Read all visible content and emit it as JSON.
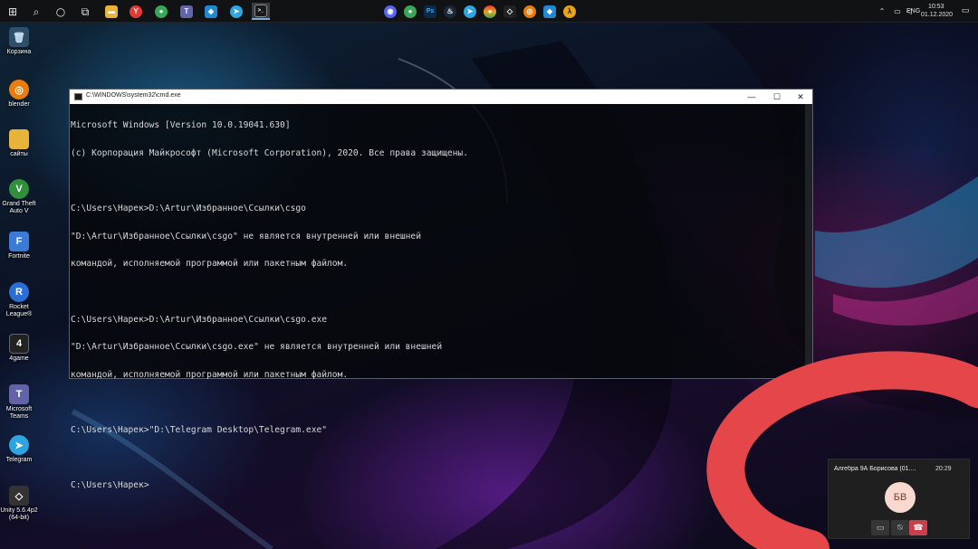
{
  "taskbar": {
    "left_buttons": [
      {
        "name": "start-button",
        "glyph": "⊞"
      },
      {
        "name": "search-button",
        "glyph": "⌕"
      },
      {
        "name": "cortana-button",
        "glyph": "○"
      },
      {
        "name": "task-view-button",
        "glyph": "⧉"
      }
    ],
    "pinned_apps": [
      {
        "name": "file-explorer-icon",
        "glyph": "▬",
        "color": "#e8b339"
      },
      {
        "name": "yandex-browser-icon",
        "glyph": "Y",
        "color": "#e53935"
      },
      {
        "name": "chrome-icon",
        "glyph": "●",
        "color": "#3aa757"
      },
      {
        "name": "teams-icon",
        "glyph": "T",
        "color": "#6264a7"
      },
      {
        "name": "vscode-icon",
        "glyph": "◆",
        "color": "#1f8ad2"
      },
      {
        "name": "telegram-icon",
        "glyph": "➤",
        "color": "#2ca5e0"
      },
      {
        "name": "cmd-icon",
        "glyph": ">_",
        "color": "#1a1a1a"
      }
    ],
    "tray_apps": [
      {
        "name": "discord-tray-icon",
        "glyph": "◉",
        "color": "#5865f2"
      },
      {
        "name": "chrome-tray-icon",
        "glyph": "●",
        "color": "#3aa757"
      },
      {
        "name": "photoshop-tray-icon",
        "glyph": "Ps",
        "color": "#0b2a4a"
      },
      {
        "name": "steam-tray-icon",
        "glyph": "♨",
        "color": "#1b2838"
      },
      {
        "name": "telegram-tray-icon",
        "glyph": "➤",
        "color": "#2ca5e0"
      },
      {
        "name": "game-tray-icon",
        "glyph": "●",
        "color": "#e8a21c"
      },
      {
        "name": "unity-tray-icon",
        "glyph": "◇",
        "color": "#222222"
      },
      {
        "name": "blender-tray-icon",
        "glyph": "◎",
        "color": "#e87d0d"
      },
      {
        "name": "vscode-tray-icon",
        "glyph": "◆",
        "color": "#1f8ad2"
      },
      {
        "name": "half-life-tray-icon",
        "glyph": "λ",
        "color": "#e8a21c"
      }
    ],
    "language": "ENG",
    "time": "10:53",
    "date": "01.12.2020"
  },
  "desktop_icons": [
    {
      "name": "recycle-bin",
      "label": "Корзина",
      "glyph": "🗑",
      "color": "#7fb6e6"
    },
    {
      "name": "blender",
      "label": "blender",
      "glyph": "◎",
      "color": "#e87d0d"
    },
    {
      "name": "sites-folder",
      "label": "сайты",
      "glyph": "▬",
      "color": "#e8b339"
    },
    {
      "name": "gta-v",
      "label": "Grand Theft Auto V",
      "glyph": "V",
      "color": "#2f8f3a"
    },
    {
      "name": "fortnite",
      "label": "Fortnite",
      "glyph": "F",
      "color": "#3a7bd5"
    },
    {
      "name": "rocket-league",
      "label": "Rocket League®",
      "glyph": "R",
      "color": "#2b6fd6"
    },
    {
      "name": "4game",
      "label": "4game",
      "glyph": "4",
      "color": "#222222"
    },
    {
      "name": "microsoft-teams",
      "label": "Microsoft Teams",
      "glyph": "T",
      "color": "#6264a7"
    },
    {
      "name": "telegram",
      "label": "Telegram",
      "glyph": "➤",
      "color": "#2ca5e0"
    },
    {
      "name": "unity",
      "label": "Unity 5.6.4p2 (64-bit)",
      "glyph": "◇",
      "color": "#333333"
    }
  ],
  "cmd": {
    "title": "C:\\WINDOWS\\system32\\cmd.exe",
    "minimize": "—",
    "maximize": "☐",
    "close": "✕",
    "lines": [
      "Microsoft Windows [Version 10.0.19041.630]",
      "(c) Корпорация Майкрософт (Microsoft Corporation), 2020. Все права защищены.",
      "",
      "C:\\Users\\Нарек>D:\\Artur\\Избранное\\Ссылки\\csgo",
      "\"D:\\Artur\\Избранное\\Ссылки\\csgo\" не является внутренней или внешней",
      "командой, исполняемой программой или пакетным файлом.",
      "",
      "C:\\Users\\Нарек>D:\\Artur\\Избранное\\Ссылки\\csgo.exe",
      "\"D:\\Artur\\Избранное\\Ссылки\\csgo.exe\" не является внутренней или внешней",
      "командой, исполняемой программой или пакетным файлом.",
      "",
      "C:\\Users\\Нарек>\"D:\\Telegram Desktop\\Telegram.exe\"",
      "",
      "C:\\Users\\Нарек>"
    ]
  },
  "call": {
    "title": "Алгебра 9А Борисова (01....",
    "timer": "20:29",
    "avatar": "БВ",
    "buttons": [
      {
        "name": "camera-button",
        "glyph": "▭"
      },
      {
        "name": "mute-button",
        "glyph": "⍉"
      },
      {
        "name": "hang-up-button",
        "glyph": "☎"
      }
    ]
  },
  "colors": {
    "doodle": "#e4464a"
  }
}
